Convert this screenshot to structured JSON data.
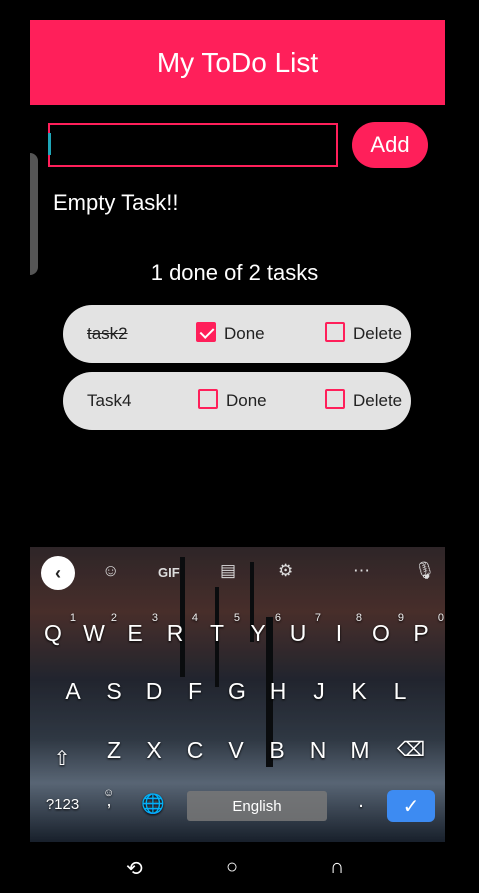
{
  "app": {
    "title": "My ToDo List",
    "input_value": "",
    "add_label": "Add",
    "message": "Empty Task!!",
    "summary": "1 done of 2 tasks"
  },
  "tasks": [
    {
      "name": "task2",
      "done": true,
      "done_label": "Done",
      "delete_label": "Delete"
    },
    {
      "name": "Task4",
      "done": false,
      "done_label": "Done",
      "delete_label": "Delete"
    }
  ],
  "keyboard": {
    "toolbar": [
      "back-icon",
      "sticker-icon",
      "gif-icon",
      "clipboard-icon",
      "gear-icon",
      "more-icon",
      "mic-icon"
    ],
    "gif_label": "GIF",
    "row1": [
      "Q",
      "W",
      "E",
      "R",
      "T",
      "Y",
      "U",
      "I",
      "O",
      "P"
    ],
    "row1_hints": [
      "1",
      "2",
      "3",
      "4",
      "5",
      "6",
      "7",
      "8",
      "9",
      "0"
    ],
    "row2": [
      "A",
      "S",
      "D",
      "F",
      "G",
      "H",
      "J",
      "K",
      "L"
    ],
    "row3": [
      "Z",
      "X",
      "C",
      "V",
      "B",
      "N",
      "M"
    ],
    "symbols_label": "?123",
    "comma_label": ",",
    "space_label": "English",
    "period_label": ".",
    "enter_icon": "check-icon"
  },
  "navbar": [
    "recent-apps-icon",
    "home-icon",
    "back-icon"
  ],
  "colors": {
    "accent": "#FF1F5A",
    "enter": "#3D8BF2",
    "task_bg": "#E3E3E3"
  }
}
